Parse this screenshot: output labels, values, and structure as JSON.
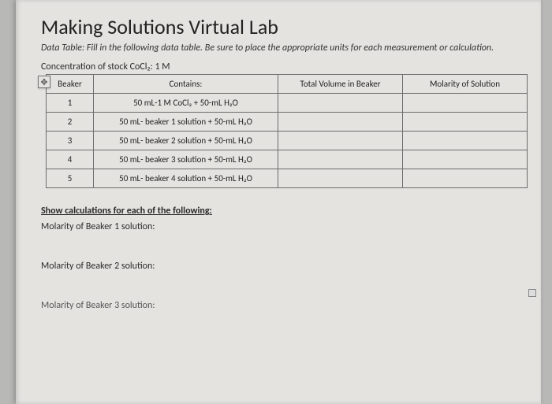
{
  "title": "Making Solutions Virtual Lab",
  "subtitle": "Data Table: Fill in the following data table. Be sure to place the appropriate units for each measurement or calculation.",
  "stock_line": "Concentration of stock CoCl₂: 1 M",
  "move_handle_glyph": "✥",
  "table": {
    "headers": {
      "beaker": "Beaker",
      "contains": "Contains:",
      "total_volume": "Total Volume in Beaker",
      "molarity": "Molarity of Solution"
    },
    "rows": [
      {
        "beaker": "1",
        "contains": "50 mL-1 M CoCl₂ + 50-mL H₂O",
        "total_volume": "",
        "molarity": ""
      },
      {
        "beaker": "2",
        "contains": "50 mL- beaker 1 solution + 50-mL H₂O",
        "total_volume": "",
        "molarity": ""
      },
      {
        "beaker": "3",
        "contains": "50 mL- beaker 2 solution + 50-mL H₂O",
        "total_volume": "",
        "molarity": ""
      },
      {
        "beaker": "4",
        "contains": "50 mL- beaker 3 solution + 50-mL H₂O",
        "total_volume": "",
        "molarity": ""
      },
      {
        "beaker": "5",
        "contains": "50 mL- beaker 4 solution + 50-mL H₂O",
        "total_volume": "",
        "molarity": ""
      }
    ]
  },
  "calc_header": "Show calculations for each of the following:",
  "calc_lines": {
    "b1": "Molarity of Beaker 1 solution:",
    "b2": "Molarity of Beaker 2 solution:",
    "b3": "Molarity of Beaker 3 solution:"
  }
}
